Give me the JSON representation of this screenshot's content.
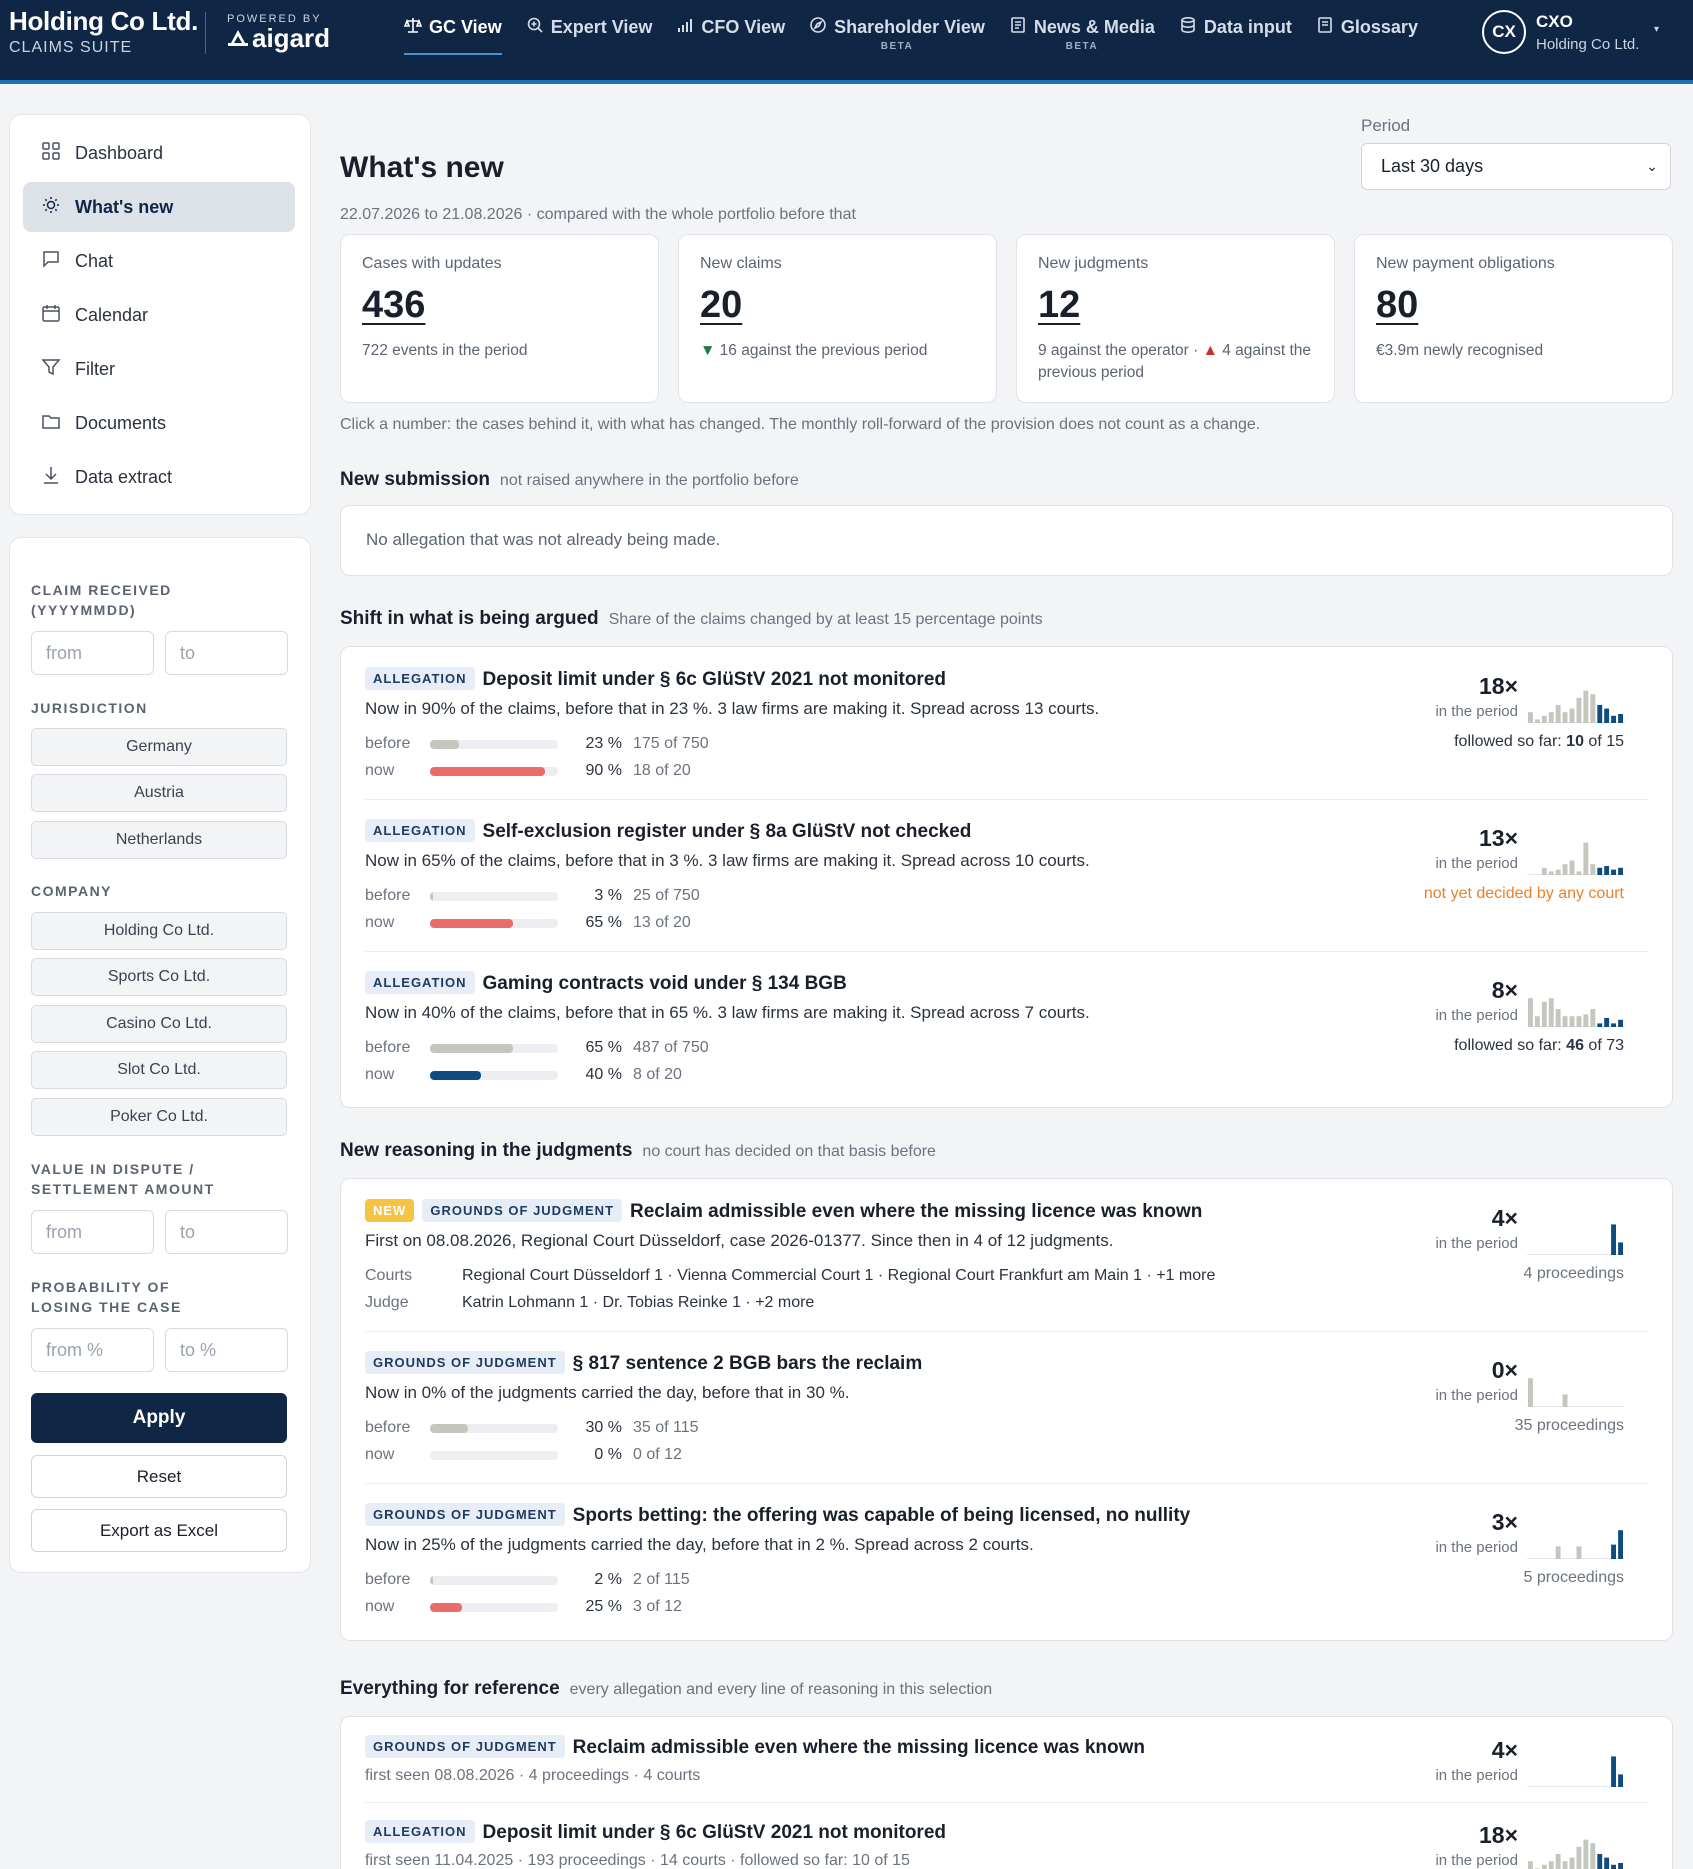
{
  "brand": {
    "name": "Holding Co Ltd.",
    "suite": "CLAIMS SUITE",
    "powered_by": "POWERED BY",
    "logo": "aigard"
  },
  "nav": [
    {
      "label": "GC View",
      "icon": "scale-icon",
      "active": true
    },
    {
      "label": "Expert View",
      "icon": "zoom-icon"
    },
    {
      "label": "CFO View",
      "icon": "bar-chart-icon"
    },
    {
      "label": "Shareholder View",
      "icon": "compass-icon",
      "badge": "BETA"
    },
    {
      "label": "News & Media",
      "icon": "newspaper-icon",
      "badge": "BETA"
    },
    {
      "label": "Data input",
      "icon": "database-icon"
    },
    {
      "label": "Glossary",
      "icon": "book-icon"
    }
  ],
  "user": {
    "initials": "CX",
    "name": "CXO",
    "company": "Holding Co Ltd."
  },
  "sidebar": {
    "items": [
      {
        "label": "Dashboard",
        "icon": "grid-icon"
      },
      {
        "label": "What's new",
        "icon": "sun-icon",
        "active": true
      },
      {
        "label": "Chat",
        "icon": "chat-icon"
      },
      {
        "label": "Calendar",
        "icon": "calendar-icon"
      },
      {
        "label": "Filter",
        "icon": "funnel-icon"
      },
      {
        "label": "Documents",
        "icon": "folder-icon"
      },
      {
        "label": "Data extract",
        "icon": "download-icon"
      }
    ]
  },
  "filters": {
    "claim_received": {
      "label": "CLAIM RECEIVED (YYYYMMDD)",
      "from": "from",
      "to": "to"
    },
    "jurisdiction": {
      "label": "JURISDICTION",
      "options": [
        "Germany",
        "Austria",
        "Netherlands"
      ]
    },
    "company": {
      "label": "COMPANY",
      "options": [
        "Holding Co Ltd.",
        "Sports Co Ltd.",
        "Casino Co Ltd.",
        "Slot Co Ltd.",
        "Poker Co Ltd."
      ]
    },
    "value": {
      "label": "VALUE IN DISPUTE / SETTLEMENT AMOUNT",
      "from": "from",
      "to": "to"
    },
    "probability": {
      "label": "PROBABILITY OF LOSING THE CASE",
      "from": "from %",
      "to": "to %"
    },
    "apply": "Apply",
    "reset": "Reset",
    "export": "Export as Excel"
  },
  "page": {
    "title": "What's new",
    "period_label": "Period",
    "period_value": "Last 30 days",
    "subtitle": "22.07.2026 to 21.08.2026 · compared with the whole portfolio before that",
    "hint": "Click a number: the cases behind it, with what has changed. The monthly roll-forward of the provision does not count as a change."
  },
  "kpis": [
    {
      "label": "Cases with updates",
      "value": "436",
      "sub": "722 events in the period"
    },
    {
      "label": "New claims",
      "value": "20",
      "delta_arrow": "▼",
      "sub": "16 against the previous period"
    },
    {
      "label": "New judgments",
      "value": "12",
      "sub_a": "9 against the operator ·",
      "delta_arrow": "▲",
      "sub_b": "4 against the previous period"
    },
    {
      "label": "New payment obligations",
      "value": "80",
      "sub": "€3.9m newly recognised"
    }
  ],
  "new_submission": {
    "title": "New submission",
    "desc": "not raised anywhere in the portfolio before",
    "empty": "No allegation that was not already being made."
  },
  "shift": {
    "title": "Shift in what is being argued",
    "desc": "Share of the claims changed by at least 15 percentage points",
    "items": [
      {
        "tag": "ALLEGATION",
        "title": "Deposit limit under § 6c GlüStV 2021 not monitored",
        "desc": "Now in 90% of the claims, before that in 23 %. 3 law firms are making it. Spread across 13 courts.",
        "before": {
          "label": "before",
          "pct": "23 %",
          "count": "175 of 750",
          "value": 0.23
        },
        "now": {
          "label": "now",
          "pct": "90 %",
          "count": "18 of 20",
          "value": 0.9,
          "color": "#e86c6c"
        },
        "count": "18×",
        "period": "in the period",
        "note_a": "followed so far: ",
        "note_b": "10",
        "note_c": " of 15",
        "spark": [
          0.3,
          0.1,
          0.2,
          0.3,
          0.5,
          0.3,
          0.4,
          0.7,
          0.9,
          0.8,
          0.5,
          0.4,
          0.2,
          0.25
        ]
      },
      {
        "tag": "ALLEGATION",
        "title": "Self-exclusion register under § 8a GlüStV not checked",
        "desc": "Now in 65% of the claims, before that in 3 %. 3 law firms are making it. Spread across 10 courts.",
        "before": {
          "label": "before",
          "pct": "3 %",
          "count": "25 of 750",
          "value": 0.03
        },
        "now": {
          "label": "now",
          "pct": "65 %",
          "count": "13 of 20",
          "value": 0.65,
          "color": "#e86c6c"
        },
        "count": "13×",
        "period": "in the period",
        "note_orange": "not yet decided by any court",
        "spark": [
          0,
          0,
          0.2,
          0.1,
          0.15,
          0.3,
          0.4,
          0.1,
          0.9,
          0.3,
          0.2,
          0.25,
          0.15,
          0.2
        ]
      },
      {
        "tag": "ALLEGATION",
        "title": "Gaming contracts void under § 134 BGB",
        "desc": "Now in 40% of the claims, before that in 65 %. 3 law firms are making it. Spread across 7 courts.",
        "before": {
          "label": "before",
          "pct": "65 %",
          "count": "487 of 750",
          "value": 0.65
        },
        "now": {
          "label": "now",
          "pct": "40 %",
          "count": "8 of 20",
          "value": 0.4,
          "color": "#0f4c81"
        },
        "count": "8×",
        "period": "in the period",
        "note_a": "followed so far: ",
        "note_b": "46",
        "note_c": " of 73",
        "spark": [
          0.8,
          0.3,
          0.7,
          0.8,
          0.5,
          0.3,
          0.3,
          0.3,
          0.35,
          0.5,
          0.1,
          0.25,
          0.1,
          0.2
        ]
      }
    ]
  },
  "reasoning": {
    "title": "New reasoning in the judgments",
    "desc": "no court has decided on that basis before",
    "items": [
      {
        "new": "NEW",
        "tag": "GROUNDS OF JUDGMENT",
        "title": "Reclaim admissible even where the missing licence was known",
        "desc": "First on 08.08.2026, Regional Court Düsseldorf, case 2026-01377. Since then in 4 of 12 judgments.",
        "courts_label": "Courts",
        "courts": "Regional Court Düsseldorf 1 · Vienna Commercial Court 1 · Regional Court Frankfurt am Main 1 · +1 more",
        "judge_label": "Judge",
        "judge": "Katrin Lohmann 1 · Dr. Tobias Reinke 1 · +2 more",
        "count": "4×",
        "period": "in the period",
        "sub": "4 proceedings",
        "spark": [
          0,
          0,
          0,
          0,
          0,
          0,
          0,
          0,
          0,
          0,
          0,
          0,
          0.85,
          0.35
        ]
      },
      {
        "tag": "GROUNDS OF JUDGMENT",
        "title": "§ 817 sentence 2 BGB bars the reclaim",
        "desc": "Now in 0% of the judgments carried the day, before that in 30 %.",
        "before": {
          "label": "before",
          "pct": "30 %",
          "count": "35 of 115",
          "value": 0.3
        },
        "now": {
          "label": "now",
          "pct": "0 %",
          "count": "0 of 12",
          "value": 0,
          "color": "#e86c6c"
        },
        "count": "0×",
        "period": "in the period",
        "sub": "35 proceedings",
        "spark": [
          0.8,
          0,
          0,
          0,
          0,
          0.35,
          0,
          0,
          0,
          0,
          0,
          0,
          0,
          0
        ]
      },
      {
        "tag": "GROUNDS OF JUDGMENT",
        "title": "Sports betting: the offering was capable of being licensed, no nullity",
        "desc": "Now in 25% of the judgments carried the day, before that in 2 %. Spread across 2 courts.",
        "before": {
          "label": "before",
          "pct": "2 %",
          "count": "2 of 115",
          "value": 0.02
        },
        "now": {
          "label": "now",
          "pct": "25 %",
          "count": "3 of 12",
          "value": 0.25,
          "color": "#e86c6c"
        },
        "count": "3×",
        "period": "in the period",
        "sub": "5 proceedings",
        "spark": [
          0,
          0,
          0,
          0,
          0.35,
          0,
          0,
          0.35,
          0,
          0,
          0,
          0,
          0.4,
          0.8
        ]
      }
    ]
  },
  "reference": {
    "title": "Everything for reference",
    "desc": "every allegation and every line of reasoning in this selection",
    "items": [
      {
        "tag": "GROUNDS OF JUDGMENT",
        "title": "Reclaim admissible even where the missing licence was known",
        "sub": "first seen 08.08.2026 · 4 proceedings · 4 courts",
        "count": "4×",
        "period": "in the period",
        "spark": [
          0,
          0,
          0,
          0,
          0,
          0,
          0,
          0,
          0,
          0,
          0,
          0,
          0.85,
          0.35
        ]
      },
      {
        "tag": "ALLEGATION",
        "title": "Deposit limit under § 6c GlüStV 2021 not monitored",
        "sub": "first seen 11.04.2025 · 193 proceedings · 14 courts · followed so far: 10 of 15",
        "count": "18×",
        "period": "in the period",
        "spark": [
          0.3,
          0.1,
          0.2,
          0.3,
          0.5,
          0.3,
          0.4,
          0.7,
          0.9,
          0.8,
          0.5,
          0.4,
          0.2,
          0.25
        ]
      }
    ]
  },
  "colors": {
    "navy": "#0f2744",
    "accent": "#1f6fb2",
    "bar_gray": "#c4c7bd",
    "bar_navy": "#0f4c81",
    "bar_red": "#e86c6c",
    "orange": "#e8812c"
  }
}
